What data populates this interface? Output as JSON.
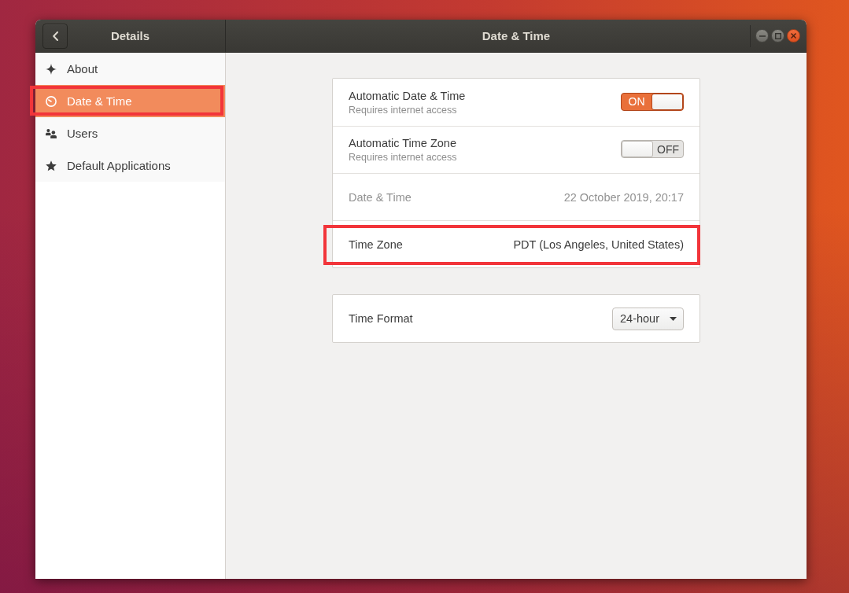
{
  "header": {
    "sidebar_title": "Details",
    "title": "Date & Time"
  },
  "sidebar": {
    "items": [
      {
        "label": "About",
        "selected": false,
        "annotated": false
      },
      {
        "label": "Date & Time",
        "selected": true,
        "annotated": true
      },
      {
        "label": "Users",
        "selected": false,
        "annotated": false
      },
      {
        "label": "Default Applications",
        "selected": false,
        "annotated": false
      }
    ]
  },
  "panel": {
    "groups": [
      {
        "rows": [
          {
            "kind": "switch",
            "label": "Automatic Date & Time",
            "subtitle": "Requires internet access",
            "on": true,
            "state_text": "ON",
            "disabled": false,
            "annotated": false
          },
          {
            "kind": "switch",
            "label": "Automatic Time Zone",
            "subtitle": "Requires internet access",
            "on": false,
            "state_text": "OFF",
            "disabled": false,
            "annotated": false
          },
          {
            "kind": "value",
            "label": "Date & Time",
            "value": "22 October 2019, 20:17",
            "disabled": true,
            "annotated": false
          },
          {
            "kind": "value",
            "label": "Time Zone",
            "value": "PDT (Los Angeles, United States)",
            "disabled": false,
            "annotated": true
          }
        ]
      },
      {
        "rows": [
          {
            "kind": "dropdown",
            "label": "Time Format",
            "value": "24-hour",
            "disabled": false,
            "annotated": false
          }
        ]
      }
    ]
  }
}
